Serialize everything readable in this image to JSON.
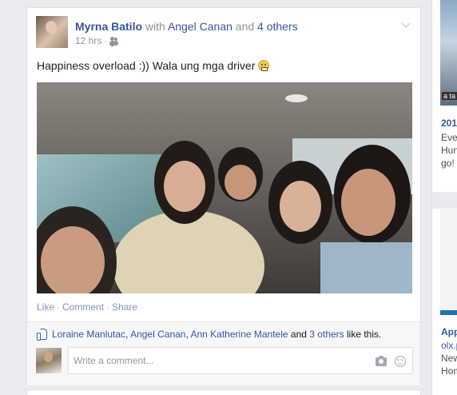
{
  "post": {
    "author": "Myrna Batilo",
    "with_word": "with",
    "tagged_friend": "Angel Canan",
    "and_word": "and",
    "others": "4 others",
    "time": "12 hrs",
    "meta_sep": "·",
    "privacy_icon": "friends-icon",
    "text": "Happiness overload :)) Wala ung mga driver",
    "emoji_icon": "grimace-emoji-icon"
  },
  "actions": {
    "like": "Like",
    "comment": "Comment",
    "share": "Share",
    "sep": "·"
  },
  "likes": {
    "names": [
      "Loraine Manlutac",
      "Angel Canan",
      "Ann Katherine Mantele"
    ],
    "comma": ",",
    "and_word": "and",
    "others": "3 others",
    "suffix": "like this."
  },
  "comment": {
    "placeholder": "Write a comment..."
  },
  "sidebar": {
    "ad1_image_caption": "a ta",
    "ad1_title": "201",
    "ad1_lines": [
      "Eve",
      "Hun",
      "go!"
    ],
    "ad2_title": "App",
    "ad2_url": "olx.p",
    "ad2_lines": [
      "New",
      "Hom"
    ]
  },
  "colors": {
    "link": "#365899",
    "muted": "#90949c",
    "page_bg": "#e9ebee"
  }
}
